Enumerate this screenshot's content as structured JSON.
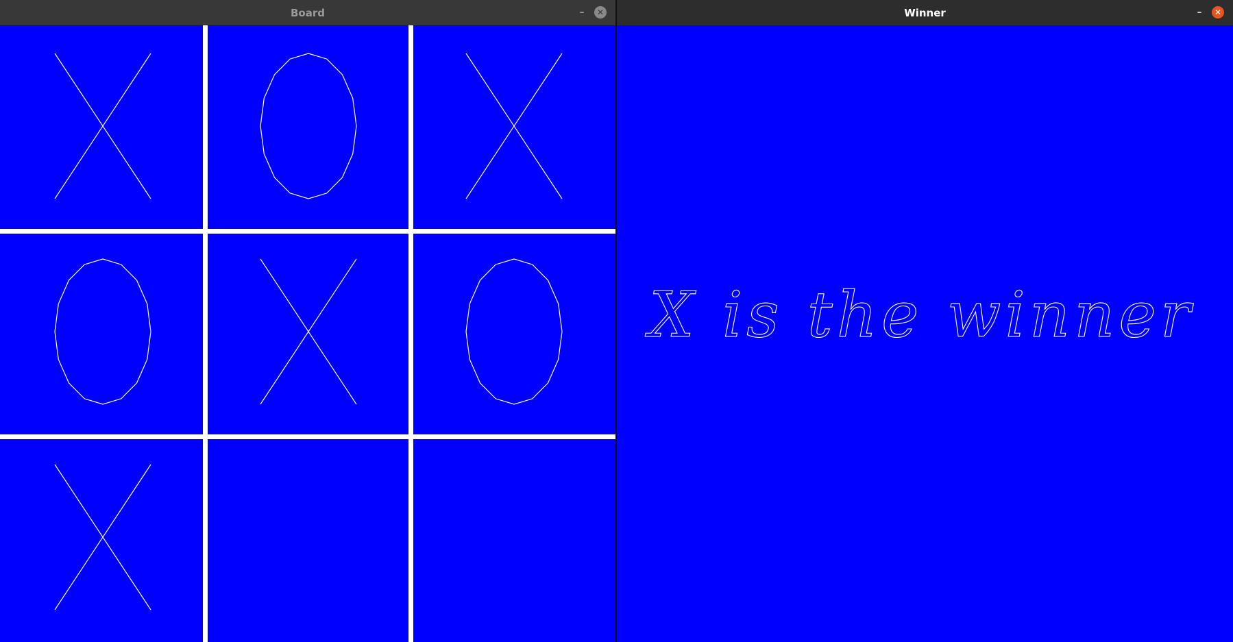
{
  "board_window": {
    "title": "Board",
    "minimize_glyph": "–",
    "close_glyph": "✕",
    "grid": [
      [
        "X",
        "O",
        "X"
      ],
      [
        "O",
        "X",
        "O"
      ],
      [
        "X",
        "",
        ""
      ]
    ]
  },
  "winner_window": {
    "title": "Winner",
    "minimize_glyph": "–",
    "close_glyph": "✕",
    "message": "X is the winner"
  },
  "colors": {
    "canvas_background": "#0000ff",
    "line_color": "#ffffff",
    "close_button_active": "#e95420"
  }
}
